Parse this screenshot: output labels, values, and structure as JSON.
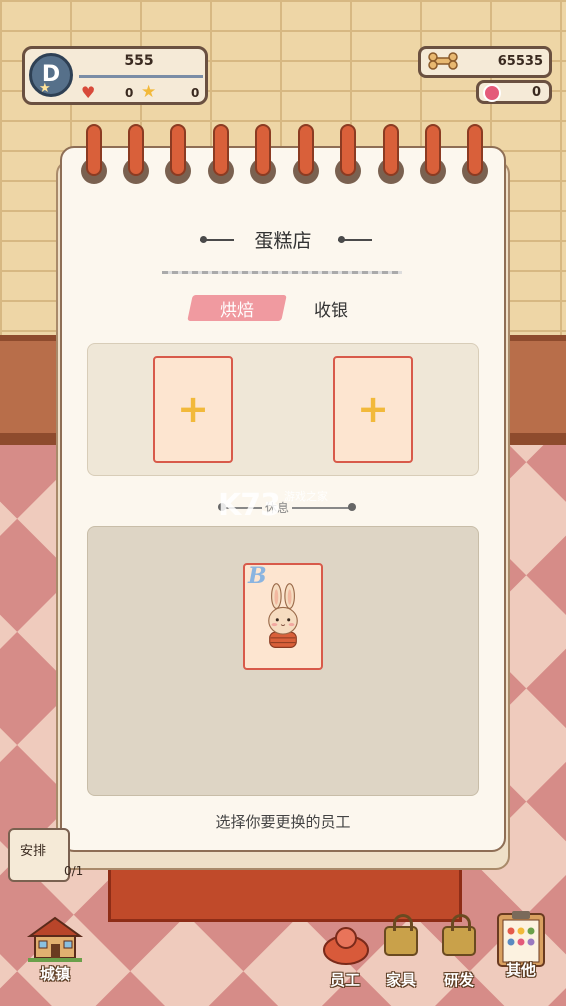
{
  "top_bar": {
    "rank": "D",
    "money": "555",
    "hearts": "0",
    "stars": "0",
    "bones": "65535",
    "candy": "0"
  },
  "notebook": {
    "title": "蛋糕店",
    "tabs": [
      {
        "label": "烘焙",
        "active": true
      },
      {
        "label": "收银",
        "active": false
      }
    ],
    "slots": [
      {
        "icon": "+"
      },
      {
        "icon": "+"
      }
    ],
    "divider_text": "休息",
    "staff": [
      {
        "grade": "B",
        "icon": "bunny-employee-icon"
      }
    ],
    "hint": "选择你要更换的员工"
  },
  "side_panel": {
    "label": "安排",
    "count": "0/1"
  },
  "bottom_nav": {
    "town": "城镇",
    "staff": "员工",
    "furniture": "家具",
    "research": "研发",
    "other": "其他"
  },
  "watermark": {
    "main": "K73",
    "sub": "游戏之家"
  },
  "colors": {
    "accent_pink": "#f09aa0",
    "slot_border": "#d85a4a",
    "plus_yellow": "#f2b93a"
  }
}
